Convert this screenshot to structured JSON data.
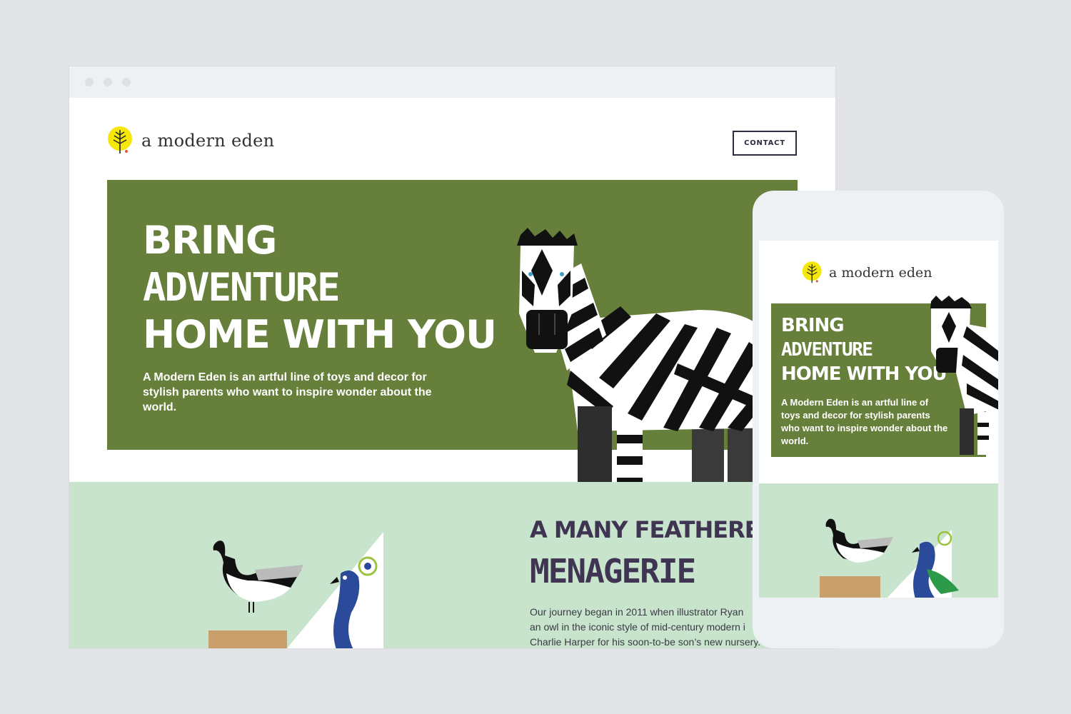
{
  "brand": {
    "name": "a modern eden",
    "logo_color": "#f5e70a"
  },
  "header": {
    "contact_label": "CONTACT"
  },
  "hero": {
    "title_line1": "BRING",
    "title_line2": "ADVENTURE",
    "title_line3": "HOME WITH YOU",
    "description": "A Modern Eden is an artful line of toys and decor for stylish parents who want to inspire wonder about the world.",
    "background_color": "#667f3a"
  },
  "section2": {
    "title_line1": "A MANY FEATHERED",
    "title_line2": "MENAGERIE",
    "body": "Our journey began in 2011 when illustrator Ryan ... an owl in the iconic style of mid-century modern i... Charlie Harper for his soon-to-be son’s new nursery.",
    "body_lines": [
      "Our journey began in 2011 when illustrator Ryan",
      "an owl in the iconic style of mid-century modern i",
      "Charlie Harper for his soon-to-be son’s new nursery."
    ],
    "background_color": "#c8e4cd"
  },
  "mobile": {
    "brand_name": "a modern eden",
    "hero_title_line1": "BRING",
    "hero_title_line2": "ADVENTURE",
    "hero_title_line3": "HOME WITH YOU",
    "hero_description": "A Modern Eden is an artful line of toys and decor for stylish parents who want to inspire wonder about the world."
  },
  "icons": {
    "logo": "tree-icon",
    "zebra": "zebra-illustration",
    "birds": "goose-peacock-illustration"
  }
}
